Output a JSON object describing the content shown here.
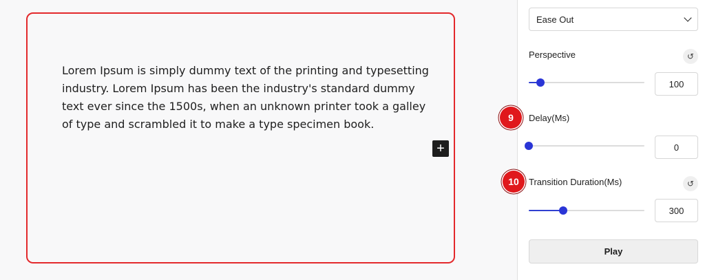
{
  "canvas": {
    "paragraph": "Lorem Ipsum is simply dummy text of the printing and typesetting industry. Lorem Ipsum has been the industry's standard dummy text ever since the 1500s, when an unknown printer took a galley of type and scrambled it to make a type specimen book.",
    "add_block_icon": "plus-icon",
    "add_block_glyph": "+"
  },
  "sidebar": {
    "easing": {
      "selected": "Ease Out"
    },
    "perspective": {
      "label": "Perspective",
      "value": "100",
      "level": 0.1
    },
    "delay": {
      "label": "Delay(Ms)",
      "value": "0",
      "level": 0.0
    },
    "duration": {
      "label": "Transition Duration(Ms)",
      "value": "300",
      "level": 0.3
    },
    "reset_glyph": "↺",
    "play_label": "Play"
  },
  "markers": {
    "delay": "9",
    "duration": "10"
  },
  "colors": {
    "accent": "#2a35d6",
    "marker": "#e0181c",
    "selection_border": "#e3282b"
  }
}
